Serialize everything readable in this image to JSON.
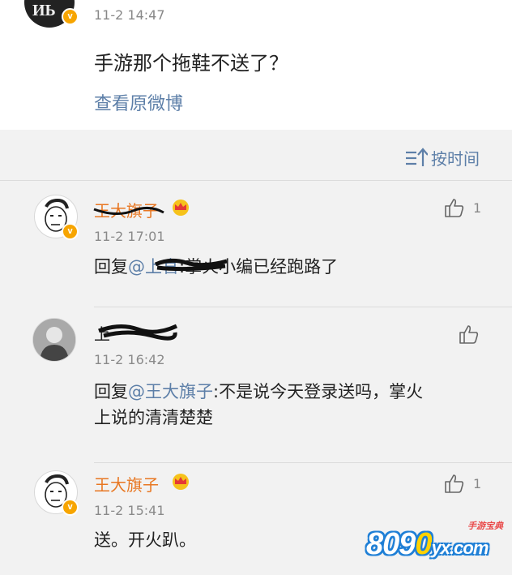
{
  "post": {
    "time": "11-2 14:47",
    "text": "手游那个拖鞋不送了？",
    "view_original": "查看原微博",
    "avatar_text": "ИЬ"
  },
  "comments_header": {
    "sort_label": "按时间"
  },
  "comments": [
    {
      "name": "王大旗子",
      "time": "11-2 17:01",
      "reply_prefix": "回复",
      "mention": "@上官",
      "body": ":掌火小编已经跑路了",
      "likes": "1"
    },
    {
      "name": "上",
      "time": "11-2 16:42",
      "reply_prefix": "回复",
      "mention": "@王大旗子",
      "body_line1": ":不是说今天登录送吗，掌火",
      "body_line2": "上说的清清楚楚"
    },
    {
      "name": "王大旗子",
      "time": "11-2 15:41",
      "body": "送。开火趴。",
      "likes": "1"
    }
  ],
  "watermark": {
    "digits_a": "8",
    "digits_b": "0",
    "digits_c": "9",
    "digits_d": "0",
    "domain": "yx.com",
    "subtitle": "手游宝典"
  },
  "colors": {
    "link": "#5d7fa8",
    "username": "#e87722",
    "badge": "#f7a500",
    "comments_bg": "#f2f2f2"
  }
}
